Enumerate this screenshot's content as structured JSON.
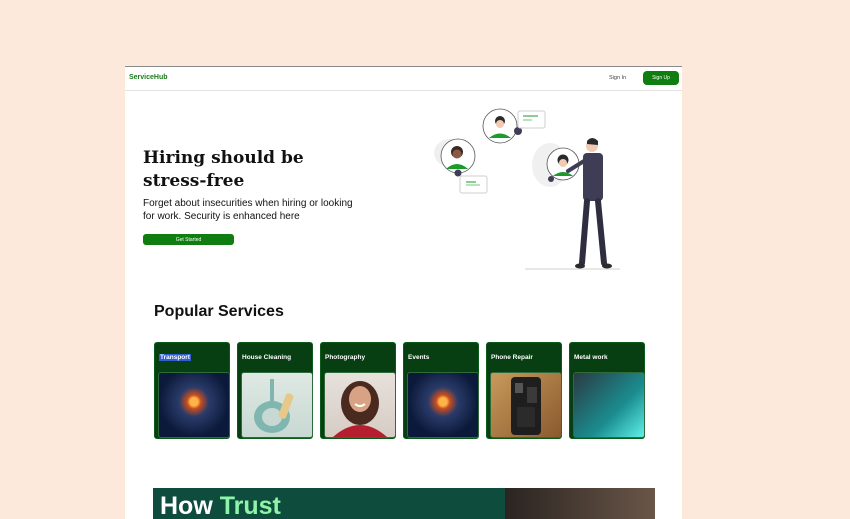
{
  "nav": {
    "brand": "ServiceHub",
    "sign_in": "Sign In",
    "sign_up": "Sign Up"
  },
  "hero": {
    "title_line1": "Hiring should be",
    "title_line2": "stress-free",
    "subtitle": "Forget about insecurities when hiring or looking for work. Security is enhanced here",
    "cta": "Get Started"
  },
  "services": {
    "title": "Popular Services",
    "items": [
      {
        "label": "Transport",
        "image": "sparkler-image"
      },
      {
        "label": "House Cleaning",
        "image": "brush-dustpan-image"
      },
      {
        "label": "Photography",
        "image": "portrait-image"
      },
      {
        "label": "Events",
        "image": "sparkler-image"
      },
      {
        "label": "Phone Repair",
        "image": "phone-board-image"
      },
      {
        "label": "Metal work",
        "image": "welding-image"
      }
    ]
  },
  "banner": {
    "text_white": "How",
    "text_accent": "Trust"
  },
  "colors": {
    "background": "#fde9dc",
    "brand_green": "#0f7d0f",
    "card_green": "#083f12",
    "banner_green": "#0e4c3d",
    "accent_mint": "#8ef5a8"
  }
}
